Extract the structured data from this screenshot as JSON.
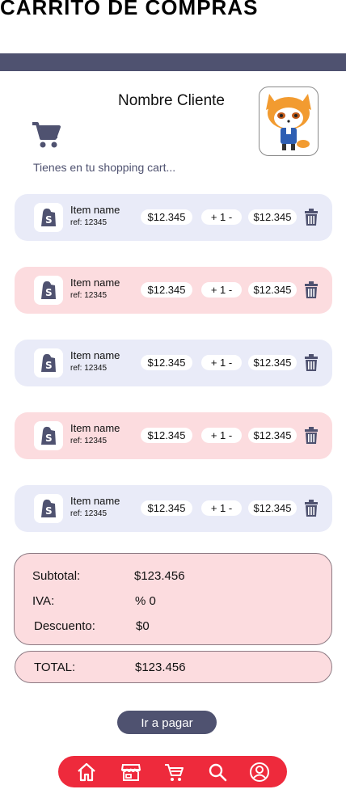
{
  "page": {
    "title": "CARRITO DE COMPRAS"
  },
  "header": {
    "customer_name": "Nombre Cliente",
    "subtitle": "Tienes en tu shopping cart...",
    "cart_icon": "cart-icon",
    "avatar_icon": "red-panda-avatar"
  },
  "items": [
    {
      "name": "Item name",
      "ref": "ref: 12345",
      "price": "$12.345",
      "qty": "+ 1 -",
      "total": "$12.345",
      "bg": "#e9ebf8"
    },
    {
      "name": "Item name",
      "ref": "ref: 12345",
      "price": "$12.345",
      "qty": "+ 1 -",
      "total": "$12.345",
      "bg": "#fcdcdf"
    },
    {
      "name": "Item name",
      "ref": "ref: 12345",
      "price": "$12.345",
      "qty": "+ 1 -",
      "total": "$12.345",
      "bg": "#e9ebf8"
    },
    {
      "name": "Item name",
      "ref": "ref: 12345",
      "price": "$12.345",
      "qty": "+ 1 -",
      "total": "$12.345",
      "bg": "#fcdcdf"
    },
    {
      "name": "Item name",
      "ref": "ref: 12345",
      "price": "$12.345",
      "qty": "+ 1 -",
      "total": "$12.345",
      "bg": "#e9ebf8"
    }
  ],
  "summary": {
    "subtotal_label": "Subtotal:",
    "subtotal_value": "$123.456",
    "iva_label": "IVA:",
    "iva_value": "% 0",
    "discount_label": "Descuento:",
    "discount_value": "$0",
    "total_label": "TOTAL:",
    "total_value": "$123.456"
  },
  "actions": {
    "pay_label": "Ir a pagar"
  },
  "nav": {
    "icons": [
      "home-icon",
      "store-icon",
      "cart-icon",
      "search-icon",
      "profile-icon"
    ]
  },
  "colors": {
    "accent": "#4f5270",
    "nav": "#ee2a3c",
    "row_blue": "#e9ebf8",
    "row_pink": "#fcdcdf"
  }
}
